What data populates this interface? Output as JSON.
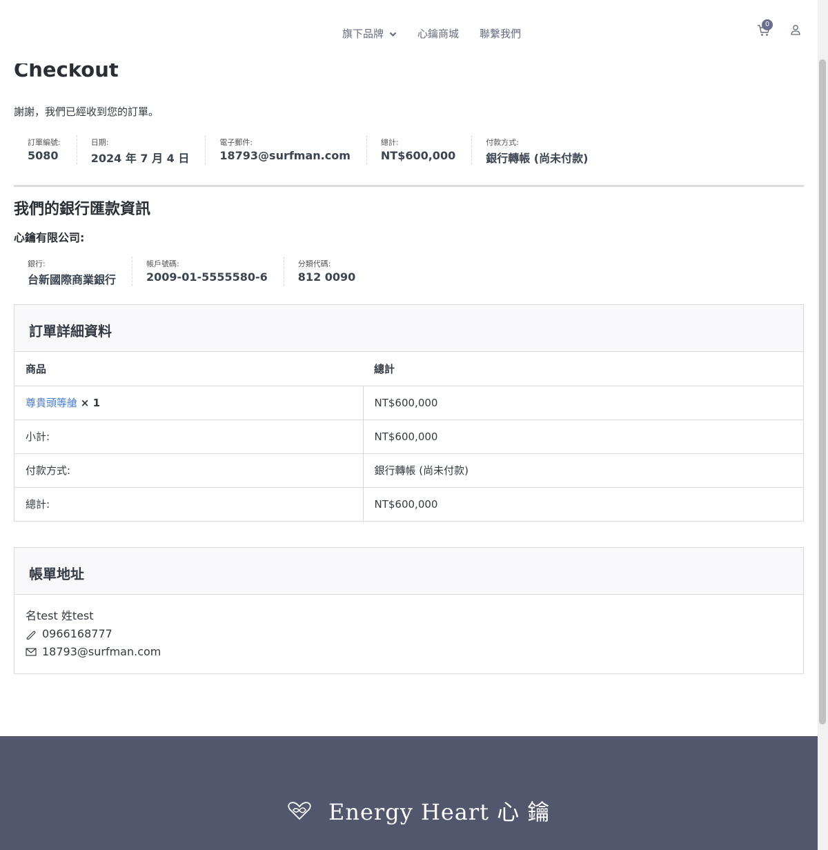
{
  "nav": {
    "items": [
      "旗下品牌",
      "心鑰商城",
      "聯繫我們"
    ],
    "cart_count": "0"
  },
  "page_title": "Checkout",
  "thanks": "謝謝，我們已經收到您的訂單。",
  "overview": [
    {
      "label": "訂單編號:",
      "value": "5080"
    },
    {
      "label": "日期:",
      "value": "2024 年 7 月 4 日"
    },
    {
      "label": "電子郵件:",
      "value": "18793@surfman.com"
    },
    {
      "label": "總計:",
      "value": "NT$600,000"
    },
    {
      "label": "付款方式:",
      "value": "銀行轉帳 (尚未付款)"
    }
  ],
  "bank": {
    "title": "我們的銀行匯款資訊",
    "company": "心鑰有限公司:",
    "fields": [
      {
        "label": "銀行:",
        "value": "台新國際商業銀行"
      },
      {
        "label": "帳戶號碼:",
        "value": "2009-01-5555580-6"
      },
      {
        "label": "分類代碼:",
        "value": "812 0090"
      }
    ]
  },
  "order_details": {
    "title": "訂單詳細資料",
    "headers": [
      "商品",
      "總計"
    ],
    "product": {
      "name": "尊貴頭等艙",
      "qty": "× 1",
      "total": "NT$600,000"
    },
    "rows": [
      {
        "label": "小計:",
        "value": "NT$600,000"
      },
      {
        "label": "付款方式:",
        "value": "銀行轉帳 (尚未付款)"
      },
      {
        "label": "總計:",
        "value": "NT$600,000"
      }
    ]
  },
  "billing": {
    "title": "帳單地址",
    "name": "名test 姓test",
    "phone": "0966168777",
    "email": "18793@surfman.com"
  },
  "footer": {
    "logo_text": "Energy Heart 心 鑰"
  },
  "colors": {
    "footer_bg": "#53576e",
    "link": "#4a7ecf",
    "badge": "#6b6e8e"
  }
}
